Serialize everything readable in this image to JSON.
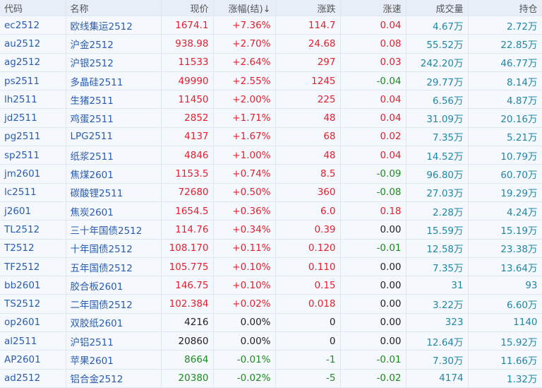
{
  "columns": [
    "代码",
    "名称",
    "现价",
    "涨幅(结)↓",
    "涨跌",
    "涨速",
    "成交量",
    "持仓"
  ],
  "colors": {
    "up": "#e5202e",
    "down": "#1f8a1f",
    "flat": "#222222",
    "volume": "#1f87a6",
    "code": "#2a5db0"
  },
  "rows": [
    {
      "code": "ec2512",
      "name": "欧线集运2512",
      "price": "1674.1",
      "pct": "+7.36%",
      "chg": "114.7",
      "speed": "0.04",
      "vol": "4.67万",
      "oi": "2.72万"
    },
    {
      "code": "au2512",
      "name": "沪金2512",
      "price": "938.98",
      "pct": "+2.70%",
      "chg": "24.68",
      "speed": "0.08",
      "vol": "55.52万",
      "oi": "22.85万"
    },
    {
      "code": "ag2512",
      "name": "沪银2512",
      "price": "11533",
      "pct": "+2.64%",
      "chg": "297",
      "speed": "0.03",
      "vol": "242.20万",
      "oi": "46.77万"
    },
    {
      "code": "ps2511",
      "name": "多晶硅2511",
      "price": "49990",
      "pct": "+2.55%",
      "chg": "1245",
      "speed": "-0.04",
      "vol": "29.77万",
      "oi": "8.14万"
    },
    {
      "code": "lh2511",
      "name": "生猪2511",
      "price": "11450",
      "pct": "+2.00%",
      "chg": "225",
      "speed": "0.04",
      "vol": "6.56万",
      "oi": "4.87万"
    },
    {
      "code": "jd2511",
      "name": "鸡蛋2511",
      "price": "2852",
      "pct": "+1.71%",
      "chg": "48",
      "speed": "0.04",
      "vol": "31.09万",
      "oi": "20.16万"
    },
    {
      "code": "pg2511",
      "name": "LPG2511",
      "price": "4137",
      "pct": "+1.67%",
      "chg": "68",
      "speed": "0.02",
      "vol": "7.35万",
      "oi": "5.21万"
    },
    {
      "code": "sp2511",
      "name": "纸浆2511",
      "price": "4846",
      "pct": "+1.00%",
      "chg": "48",
      "speed": "0.04",
      "vol": "14.52万",
      "oi": "10.79万"
    },
    {
      "code": "jm2601",
      "name": "焦煤2601",
      "price": "1153.5",
      "pct": "+0.74%",
      "chg": "8.5",
      "speed": "-0.09",
      "vol": "96.80万",
      "oi": "60.70万"
    },
    {
      "code": "lc2511",
      "name": "碳酸锂2511",
      "price": "72680",
      "pct": "+0.50%",
      "chg": "360",
      "speed": "-0.08",
      "vol": "27.03万",
      "oi": "19.29万"
    },
    {
      "code": "j2601",
      "name": "焦炭2601",
      "price": "1654.5",
      "pct": "+0.36%",
      "chg": "6.0",
      "speed": "0.18",
      "vol": "2.28万",
      "oi": "4.24万"
    },
    {
      "code": "TL2512",
      "name": "三十年国债2512",
      "price": "114.76",
      "pct": "+0.34%",
      "chg": "0.39",
      "speed": "0.00",
      "vol": "15.59万",
      "oi": "15.19万"
    },
    {
      "code": "T2512",
      "name": "十年国债2512",
      "price": "108.170",
      "pct": "+0.11%",
      "chg": "0.120",
      "speed": "-0.01",
      "vol": "12.58万",
      "oi": "23.38万"
    },
    {
      "code": "TF2512",
      "name": "五年国债2512",
      "price": "105.775",
      "pct": "+0.10%",
      "chg": "0.110",
      "speed": "0.00",
      "vol": "7.35万",
      "oi": "13.64万"
    },
    {
      "code": "bb2601",
      "name": "胶合板2601",
      "price": "146.75",
      "pct": "+0.10%",
      "chg": "0.15",
      "speed": "0.00",
      "vol": "31",
      "oi": "93"
    },
    {
      "code": "TS2512",
      "name": "二年国债2512",
      "price": "102.384",
      "pct": "+0.02%",
      "chg": "0.018",
      "speed": "0.00",
      "vol": "3.22万",
      "oi": "6.60万"
    },
    {
      "code": "op2601",
      "name": "双胶纸2601",
      "price": "4216",
      "pct": "0.00%",
      "chg": "0",
      "speed": "0.00",
      "vol": "323",
      "oi": "1140"
    },
    {
      "code": "al2511",
      "name": "沪铝2511",
      "price": "20860",
      "pct": "0.00%",
      "chg": "0",
      "speed": "0.00",
      "vol": "12.64万",
      "oi": "15.92万"
    },
    {
      "code": "AP2601",
      "name": "苹果2601",
      "price": "8664",
      "pct": "-0.01%",
      "chg": "-1",
      "speed": "-0.01",
      "vol": "7.30万",
      "oi": "11.66万"
    },
    {
      "code": "ad2512",
      "name": "铝合金2512",
      "price": "20380",
      "pct": "-0.02%",
      "chg": "-5",
      "speed": "-0.02",
      "vol": "4174",
      "oi": "1.32万"
    }
  ]
}
